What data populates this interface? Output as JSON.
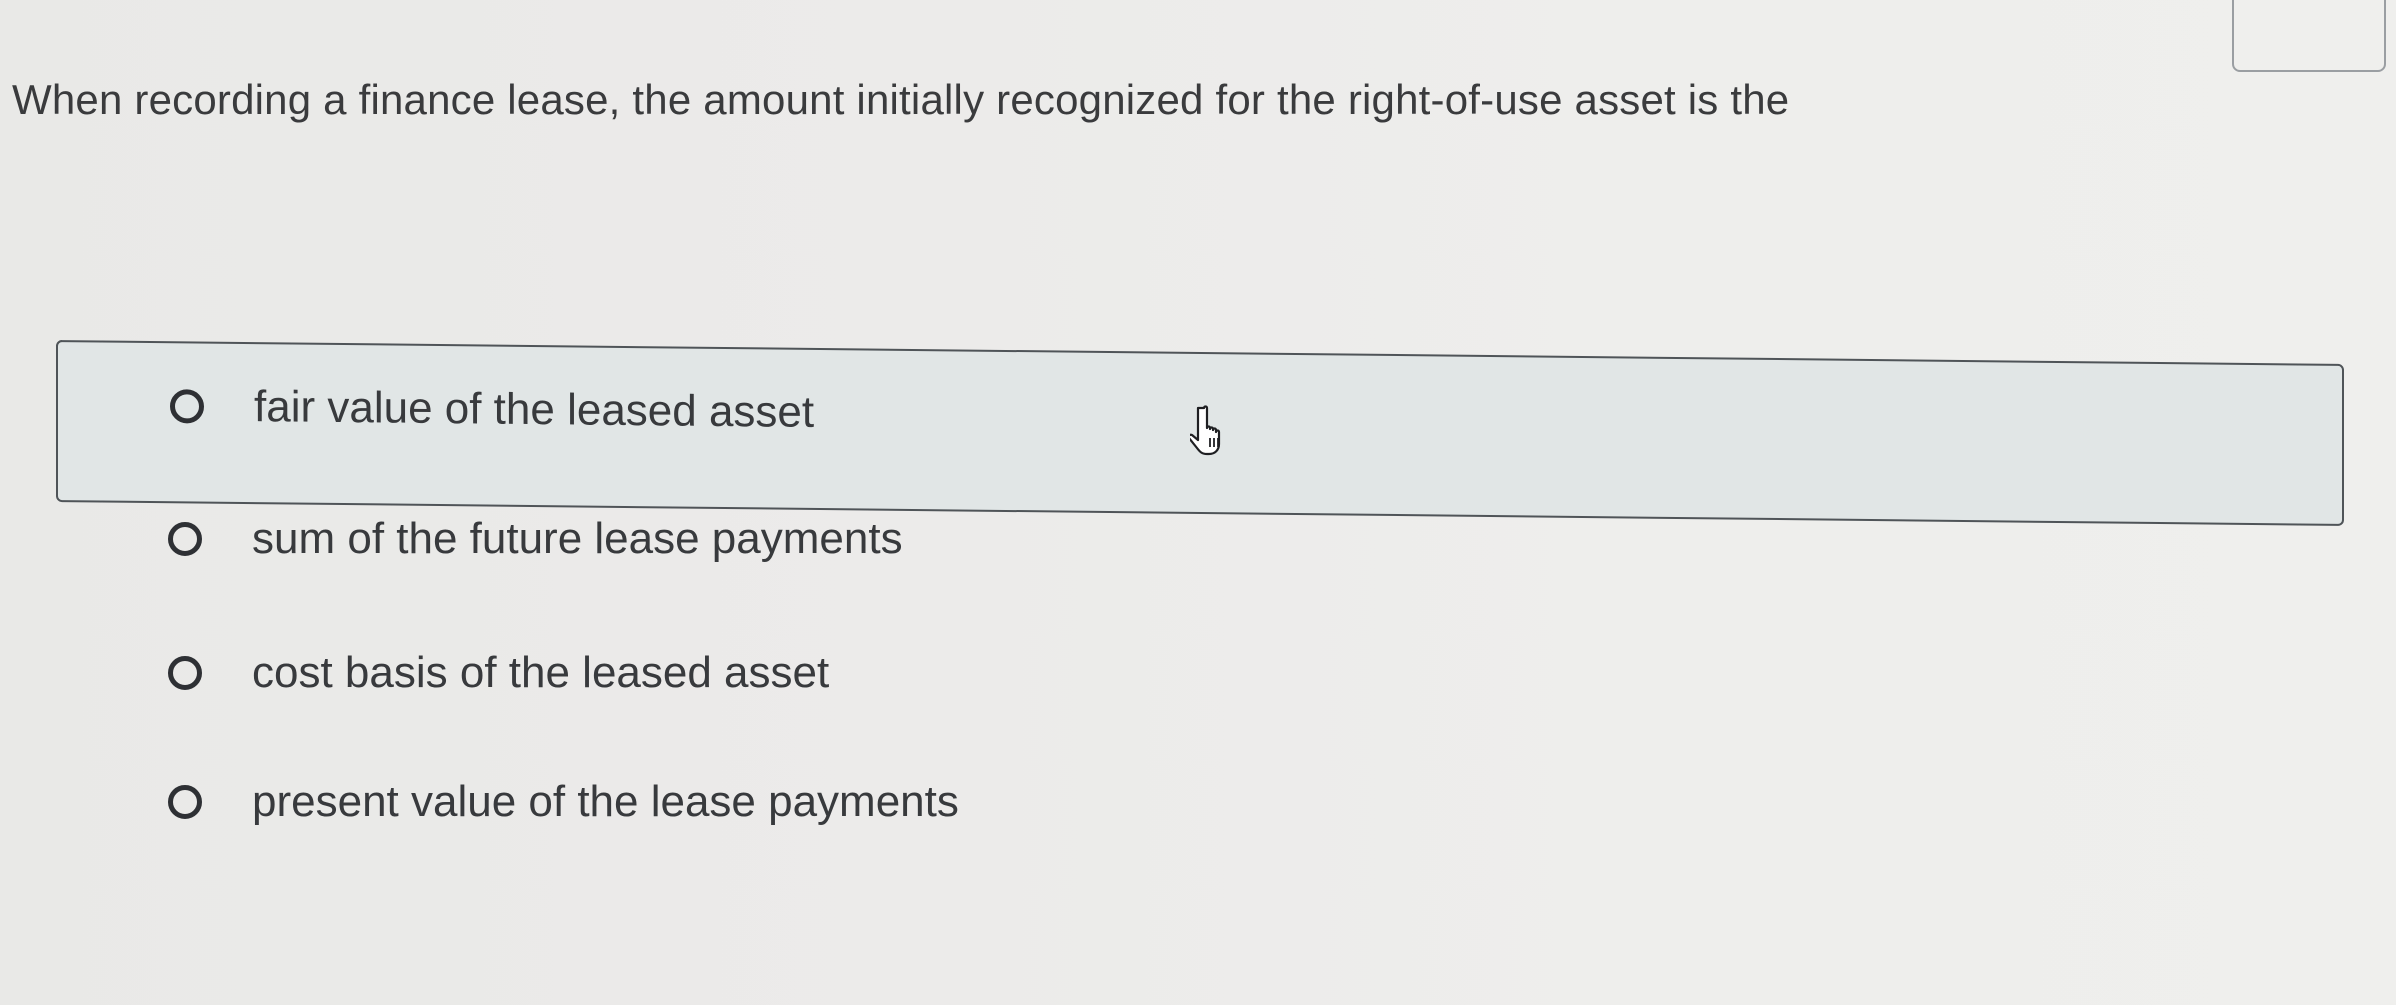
{
  "question": {
    "text": "When recording a finance lease, the amount initially recognized for the right-of-use asset is the"
  },
  "options": [
    {
      "label": "fair value of the leased asset",
      "hovered": true,
      "selected": false
    },
    {
      "label": "sum of the future lease payments",
      "hovered": false,
      "selected": false
    },
    {
      "label": "cost basis of the leased asset",
      "hovered": false,
      "selected": false
    },
    {
      "label": "present value of the lease payments",
      "hovered": false,
      "selected": false
    }
  ],
  "icons": {
    "radio": "radio-unselected-icon",
    "cursor": "hand-pointer-icon"
  },
  "colors": {
    "text": "#3a3b3d",
    "hover_background": "#e1e6e6",
    "border": "#4f5458"
  }
}
